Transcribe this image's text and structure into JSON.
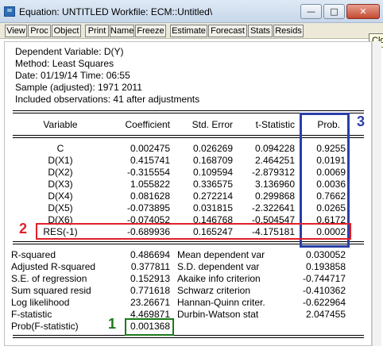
{
  "window": {
    "title": "Equation: UNTITLED   Workfile: ECM::Untitled\\",
    "app_icon": "eviews-equation-icon",
    "controls": {
      "minimize": "minimize-icon",
      "maximize": "maximize-icon",
      "close": "close-icon"
    }
  },
  "toolbar": [
    "View",
    "Proc",
    "Object",
    "Print",
    "Name",
    "Freeze",
    "Estimate",
    "Forecast",
    "Stats",
    "Resids"
  ],
  "tooltip": "Clo",
  "header": {
    "dependent": "Dependent Variable: D(Y)",
    "method": "Method: Least Squares",
    "date": "Date: 01/19/14   Time: 06:55",
    "sample": "Sample (adjusted): 1971 2011",
    "observations": "Included observations: 41 after adjustments"
  },
  "coef_table": {
    "columns": [
      "Variable",
      "Coefficient",
      "Std. Error",
      "t-Statistic",
      "Prob."
    ],
    "rows": [
      {
        "variable": "C",
        "coefficient": "0.002475",
        "std_error": "0.026269",
        "t_stat": "0.094228",
        "prob": "0.9255"
      },
      {
        "variable": "D(X1)",
        "coefficient": "0.415741",
        "std_error": "0.168709",
        "t_stat": "2.464251",
        "prob": "0.0191"
      },
      {
        "variable": "D(X2)",
        "coefficient": "-0.315554",
        "std_error": "0.109594",
        "t_stat": "-2.879312",
        "prob": "0.0069"
      },
      {
        "variable": "D(X3)",
        "coefficient": "1.055822",
        "std_error": "0.336575",
        "t_stat": "3.136960",
        "prob": "0.0036"
      },
      {
        "variable": "D(X4)",
        "coefficient": "0.081628",
        "std_error": "0.272214",
        "t_stat": "0.299868",
        "prob": "0.7662"
      },
      {
        "variable": "D(X5)",
        "coefficient": "-0.073895",
        "std_error": "0.031815",
        "t_stat": "-2.322641",
        "prob": "0.0265"
      },
      {
        "variable": "D(X6)",
        "coefficient": "-0.074052",
        "std_error": "0.146768",
        "t_stat": "-0.504547",
        "prob": "0.6172"
      },
      {
        "variable": "RES(-1)",
        "coefficient": "-0.689936",
        "std_error": "0.165247",
        "t_stat": "-4.175181",
        "prob": "0.0002"
      }
    ]
  },
  "stats": {
    "left": [
      {
        "label": "R-squared",
        "value": "0.486694"
      },
      {
        "label": "Adjusted R-squared",
        "value": "0.377811"
      },
      {
        "label": "S.E. of regression",
        "value": "0.152913"
      },
      {
        "label": "Sum squared resid",
        "value": "0.771618"
      },
      {
        "label": "Log likelihood",
        "value": "23.26671"
      },
      {
        "label": "F-statistic",
        "value": "4.469871"
      },
      {
        "label": "Prob(F-statistic)",
        "value": "0.001368"
      }
    ],
    "right": [
      {
        "label": "Mean dependent var",
        "value": "0.030052"
      },
      {
        "label": "S.D. dependent var",
        "value": "0.193858"
      },
      {
        "label": "Akaike info criterion",
        "value": "-0.744717"
      },
      {
        "label": "Schwarz criterion",
        "value": "-0.410362"
      },
      {
        "label": "Hannan-Quinn criter.",
        "value": "-0.622964"
      },
      {
        "label": "Durbin-Watson stat",
        "value": "2.047455"
      }
    ]
  },
  "annotations": {
    "marker1": {
      "label": "1",
      "color": "#1a7a1a"
    },
    "marker2": {
      "label": "2",
      "color": "#e0202a"
    },
    "marker3": {
      "label": "3",
      "color": "#2a3fa8"
    }
  }
}
